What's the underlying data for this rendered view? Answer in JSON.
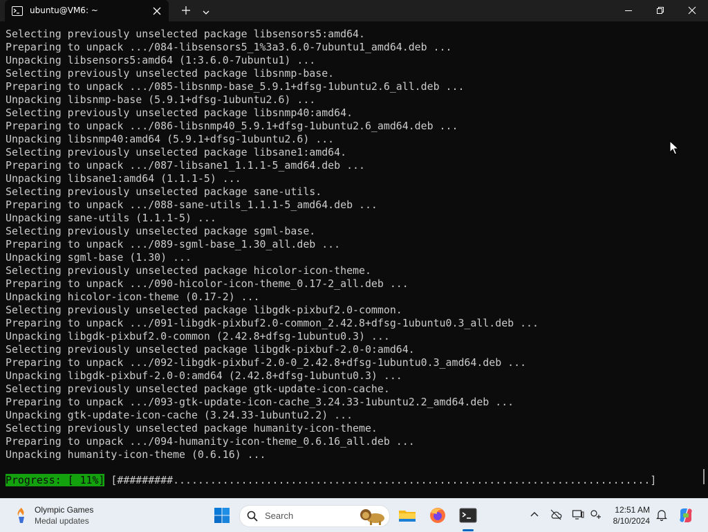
{
  "window": {
    "tab_title": "ubuntu@VM6: ~",
    "icons": {
      "tab": "terminal-icon",
      "close_tab": "close-icon",
      "new_tab": "plus-icon",
      "dropdown": "chevron-down-icon",
      "minimize": "minimize-icon",
      "restore": "restore-icon",
      "close": "close-icon"
    }
  },
  "terminal": {
    "lines": [
      "Selecting previously unselected package libsensors5:amd64.",
      "Preparing to unpack .../084-libsensors5_1%3a3.6.0-7ubuntu1_amd64.deb ...",
      "Unpacking libsensors5:amd64 (1:3.6.0-7ubuntu1) ...",
      "Selecting previously unselected package libsnmp-base.",
      "Preparing to unpack .../085-libsnmp-base_5.9.1+dfsg-1ubuntu2.6_all.deb ...",
      "Unpacking libsnmp-base (5.9.1+dfsg-1ubuntu2.6) ...",
      "Selecting previously unselected package libsnmp40:amd64.",
      "Preparing to unpack .../086-libsnmp40_5.9.1+dfsg-1ubuntu2.6_amd64.deb ...",
      "Unpacking libsnmp40:amd64 (5.9.1+dfsg-1ubuntu2.6) ...",
      "Selecting previously unselected package libsane1:amd64.",
      "Preparing to unpack .../087-libsane1_1.1.1-5_amd64.deb ...",
      "Unpacking libsane1:amd64 (1.1.1-5) ...",
      "Selecting previously unselected package sane-utils.",
      "Preparing to unpack .../088-sane-utils_1.1.1-5_amd64.deb ...",
      "Unpacking sane-utils (1.1.1-5) ...",
      "Selecting previously unselected package sgml-base.",
      "Preparing to unpack .../089-sgml-base_1.30_all.deb ...",
      "Unpacking sgml-base (1.30) ...",
      "Selecting previously unselected package hicolor-icon-theme.",
      "Preparing to unpack .../090-hicolor-icon-theme_0.17-2_all.deb ...",
      "Unpacking hicolor-icon-theme (0.17-2) ...",
      "Selecting previously unselected package libgdk-pixbuf2.0-common.",
      "Preparing to unpack .../091-libgdk-pixbuf2.0-common_2.42.8+dfsg-1ubuntu0.3_all.deb ...",
      "Unpacking libgdk-pixbuf2.0-common (2.42.8+dfsg-1ubuntu0.3) ...",
      "Selecting previously unselected package libgdk-pixbuf-2.0-0:amd64.",
      "Preparing to unpack .../092-libgdk-pixbuf-2.0-0_2.42.8+dfsg-1ubuntu0.3_amd64.deb ...",
      "Unpacking libgdk-pixbuf-2.0-0:amd64 (2.42.8+dfsg-1ubuntu0.3) ...",
      "Selecting previously unselected package gtk-update-icon-cache.",
      "Preparing to unpack .../093-gtk-update-icon-cache_3.24.33-1ubuntu2.2_amd64.deb ...",
      "Unpacking gtk-update-icon-cache (3.24.33-1ubuntu2.2) ...",
      "Selecting previously unselected package humanity-icon-theme.",
      "Preparing to unpack .../094-humanity-icon-theme_0.6.16_all.deb ...",
      "Unpacking humanity-icon-theme (0.6.16) ..."
    ],
    "progress": {
      "label": "Progress: [ 11%]",
      "bar": " [#########.............................................................................]",
      "percent": 11
    },
    "colors": {
      "background": "#0c0c0c",
      "foreground": "#cccccc",
      "progress_bg": "#13a10e"
    }
  },
  "taskbar": {
    "widget": {
      "title": "Olympic Games",
      "subtitle": "Medal updates",
      "icon": "torch-icon"
    },
    "search_placeholder": "Search",
    "apps": [
      "windows-start-icon",
      "file-explorer-icon",
      "firefox-icon",
      "terminal-icon"
    ],
    "tray": [
      "chevron-up-icon",
      "cloud-offline-icon",
      "display-icon",
      "accessibility-icon",
      "bell-icon",
      "copilot-icon"
    ],
    "clock": {
      "time": "12:51 AM",
      "date": "8/10/2024"
    }
  }
}
